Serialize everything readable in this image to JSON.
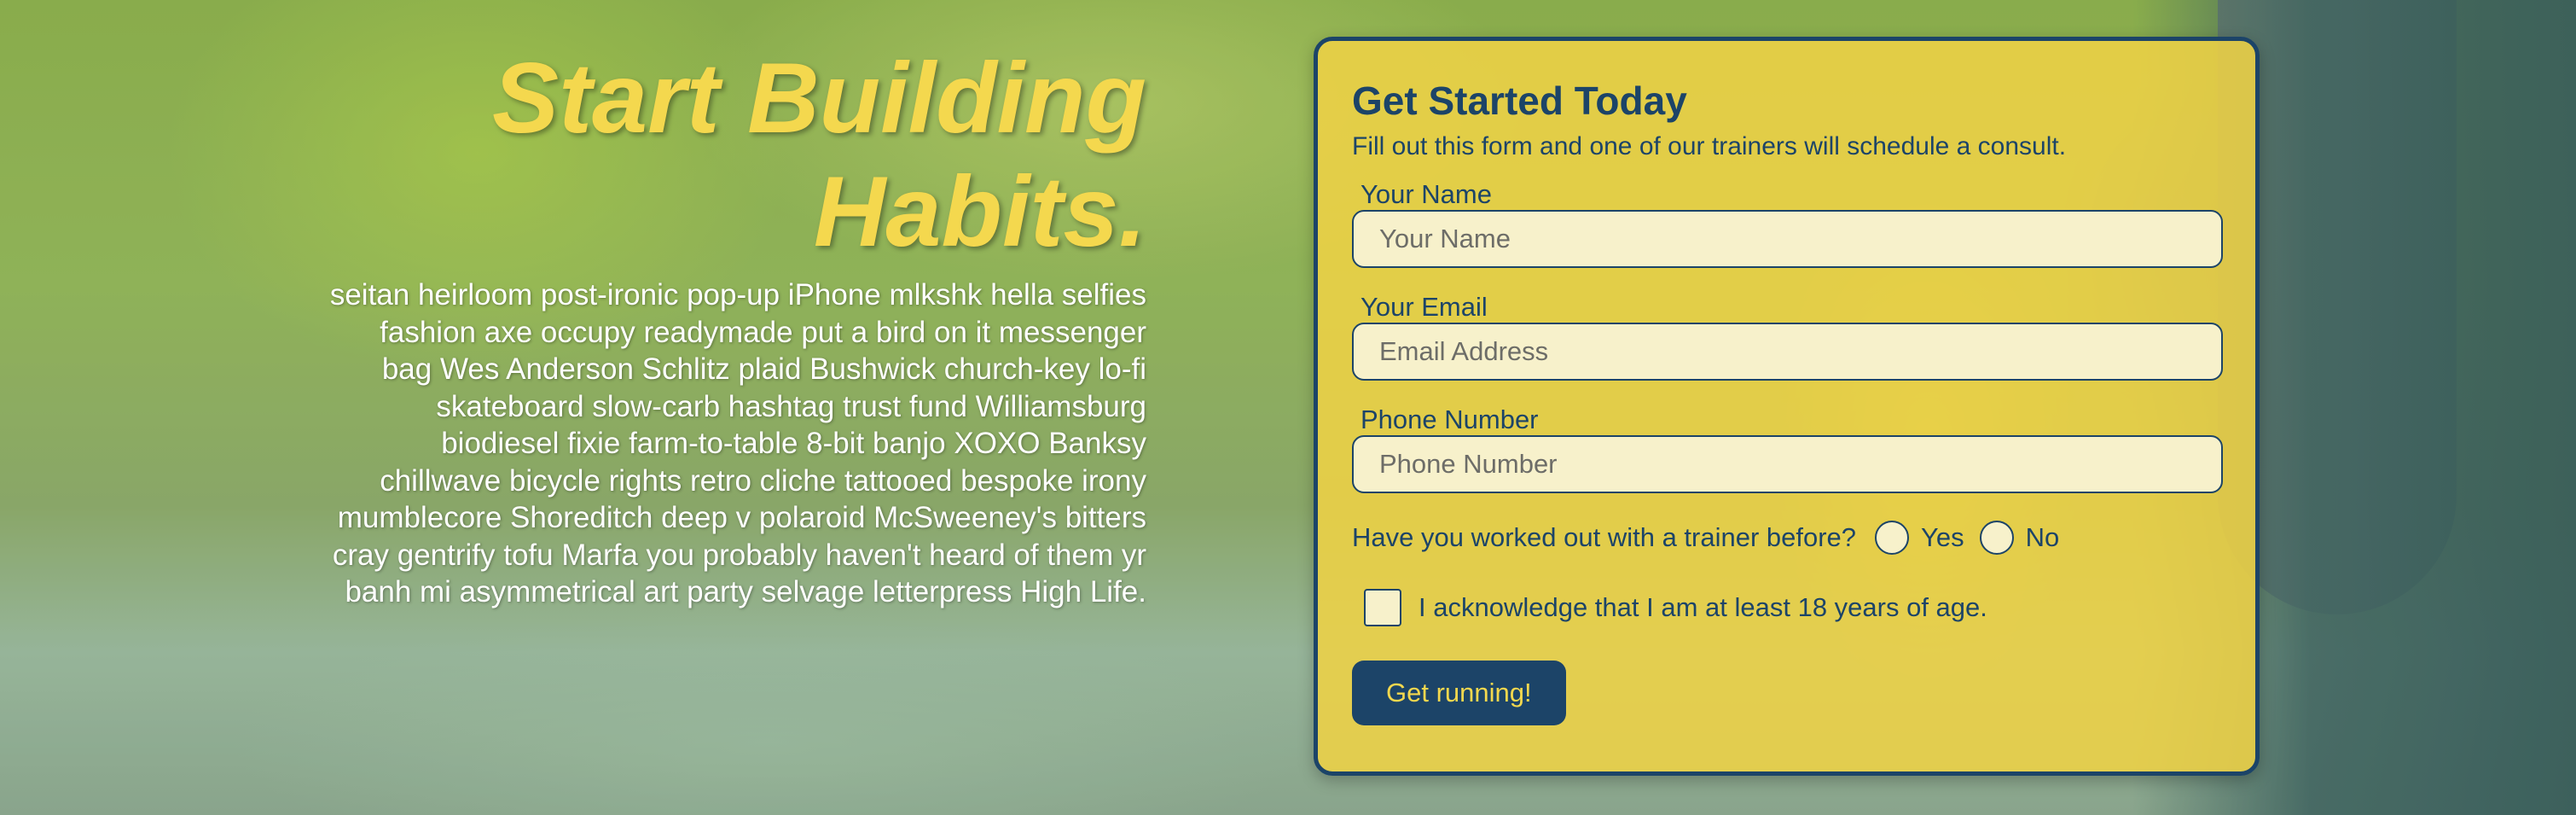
{
  "hero": {
    "title_line1": "Start Building",
    "title_line2": "Habits.",
    "body": "seitan heirloom post-ironic pop-up iPhone mlkshk hella selfies fashion axe occupy readymade put a bird on it messenger bag Wes Anderson Schlitz plaid Bushwick church-key lo-fi skateboard slow-carb hashtag trust fund Williamsburg biodiesel fixie farm-to-table 8-bit banjo XOXO Banksy chillwave bicycle rights retro cliche tattooed bespoke irony mumblecore Shoreditch deep v polaroid McSweeney's bitters cray gentrify tofu Marfa you probably haven't heard of them yr banh mi asymmetrical art party selvage letterpress High Life."
  },
  "form": {
    "title": "Get Started Today",
    "subtitle": "Fill out this form and one of our trainers will schedule a consult.",
    "name_label": "Your Name",
    "name_value": "",
    "name_placeholder": "Your Name",
    "email_label": "Your Email",
    "email_value": "",
    "email_placeholder": "Email Address",
    "phone_label": "Phone Number",
    "phone_value": "",
    "phone_placeholder": "Phone Number",
    "trainer_question": "Have you worked out with a trainer before?",
    "yes_label": "Yes",
    "no_label": "No",
    "age_ack": "I acknowledge that I am at least 18 years of age.",
    "submit_label": "Get running!"
  },
  "colors": {
    "accent_yellow": "#f4d84e",
    "navy": "#1c4468",
    "form_bg": "#eed246",
    "input_bg": "#f7f1cb"
  }
}
